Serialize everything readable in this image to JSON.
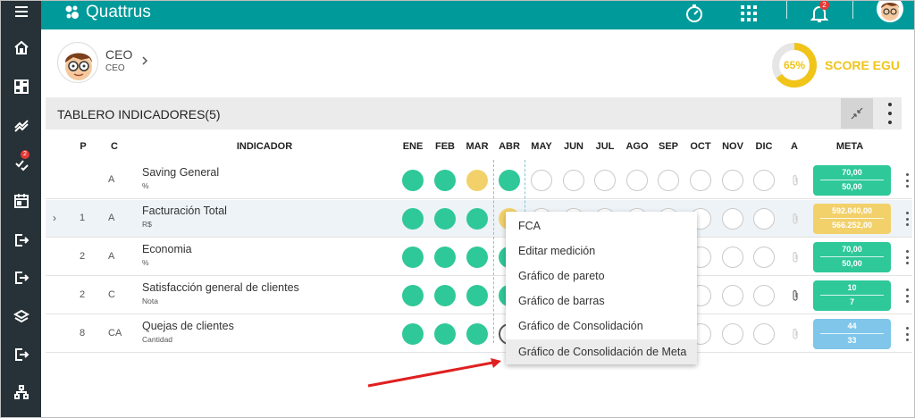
{
  "app": {
    "brand": "Quattrus",
    "notifications_count": "2",
    "sidebar_badge": "2"
  },
  "sidebar": {
    "items": [
      {
        "icon": "menu-icon"
      },
      {
        "icon": "home-icon"
      },
      {
        "icon": "dashboard-icon"
      },
      {
        "icon": "trend-icon"
      },
      {
        "icon": "checklist-icon"
      },
      {
        "icon": "calendar-icon"
      },
      {
        "icon": "export-icon"
      },
      {
        "icon": "export-icon"
      },
      {
        "icon": "layers-icon"
      },
      {
        "icon": "export-icon"
      },
      {
        "icon": "hierarchy-icon"
      }
    ]
  },
  "profile": {
    "name": "CEO",
    "role": "CEO"
  },
  "score": {
    "value": "65%",
    "percent": 65,
    "label": "SCORE EGU",
    "color": "#f0c419"
  },
  "panel": {
    "title": "TABLERO INDICADORES(5)"
  },
  "table": {
    "headers": {
      "p": "P",
      "c": "C",
      "indicator": "INDICADOR",
      "months": [
        "ENE",
        "FEB",
        "MAR",
        "ABR",
        "MAY",
        "JUN",
        "JUL",
        "AGO",
        "SEP",
        "OCT",
        "NOV",
        "DIC"
      ],
      "a": "A",
      "meta": "META"
    },
    "rows": [
      {
        "p": "",
        "c": "A",
        "name": "Saving General",
        "unit": "%",
        "months": [
          "green",
          "green",
          "yellow",
          "green",
          "empty",
          "empty",
          "empty",
          "empty",
          "empty",
          "empty",
          "empty",
          "empty"
        ],
        "meta_top": "70,00",
        "meta_bottom": "50,00",
        "meta_color": "#2fc899"
      },
      {
        "p": "1",
        "c": "A",
        "name": "Facturación Total",
        "unit": "R$",
        "months": [
          "green",
          "green",
          "green",
          "yellow",
          "empty",
          "empty",
          "empty",
          "empty",
          "empty",
          "empty",
          "empty",
          "empty"
        ],
        "meta_top": "592.040,00",
        "meta_bottom": "566.252,00",
        "meta_color": "#f2d16b"
      },
      {
        "p": "2",
        "c": "A",
        "name": "Economia",
        "unit": "%",
        "months": [
          "green",
          "green",
          "green",
          "green",
          "empty",
          "empty",
          "empty",
          "empty",
          "empty",
          "empty",
          "empty",
          "empty"
        ],
        "meta_top": "70,00",
        "meta_bottom": "50,00",
        "meta_color": "#2fc899"
      },
      {
        "p": "2",
        "c": "C",
        "name": "Satisfacción general de clientes",
        "unit": "Nota",
        "months": [
          "green",
          "green",
          "green",
          "green",
          "empty",
          "empty",
          "empty",
          "empty",
          "empty",
          "empty",
          "empty",
          "empty"
        ],
        "meta_top": "10",
        "meta_bottom": "7",
        "meta_color": "#2fc899"
      },
      {
        "p": "8",
        "c": "CA",
        "name": "Quejas de clientes",
        "unit": "Cantidad",
        "months": [
          "green",
          "green",
          "green",
          "ring",
          "empty",
          "empty",
          "empty",
          "empty",
          "empty",
          "empty",
          "empty",
          "empty"
        ],
        "meta_top": "44",
        "meta_bottom": "33",
        "meta_color": "#7fc6ea"
      }
    ]
  },
  "context_menu": {
    "items": [
      "FCA",
      "Editar medición",
      "Gráfico de pareto",
      "Gráfico de barras",
      "Gráfico de Consolidación",
      "Gráfico de Consolidación de Meta"
    ],
    "active_index": 5
  },
  "colors": {
    "topbar": "#009a9a",
    "sidebar": "#263238",
    "green": "#2fc899",
    "yellow": "#f2d16b",
    "blue": "#7fc6ea"
  }
}
